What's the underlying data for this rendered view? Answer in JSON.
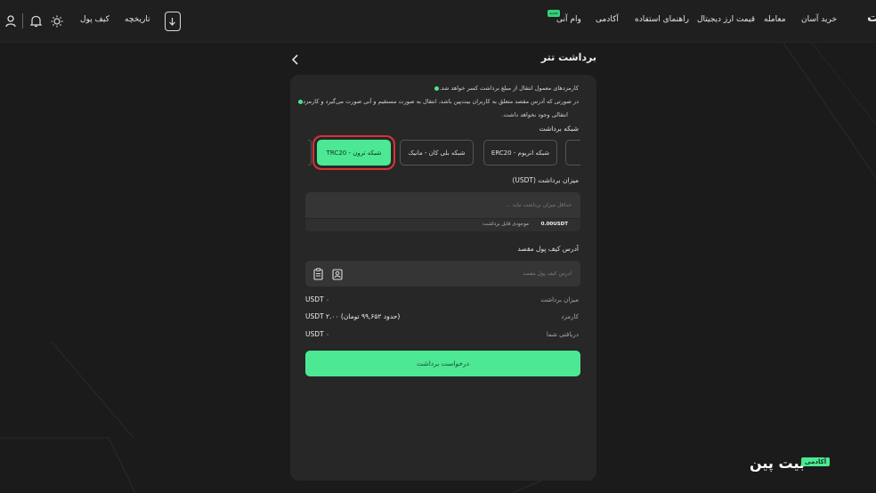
{
  "nav": {
    "items": [
      {
        "label": "خرید آسان"
      },
      {
        "label": "معامله"
      },
      {
        "label": "قیمت ارز دیجیتال"
      },
      {
        "label": "راهنمای استفاده"
      },
      {
        "label": "آکادمی"
      },
      {
        "label": "وام آنی"
      }
    ],
    "new_badge": "جدید",
    "history": "تاریخچه",
    "wallet": "کیف پول",
    "logo_char": "ت"
  },
  "page": {
    "title": "برداشت تتر"
  },
  "notes": [
    "کارمزدهای معمول انتقال از مبلغ برداشت کسر خواهد شد.",
    "در صورتی که آدرس مقصد متعلق به کاربران بیت‌پین باشد، انتقال به صورت مستقیم و آنی صورت می‌گیرد و کارمزد",
    "انتقالی وجود نخواهد داشت."
  ],
  "network": {
    "label": "شبکه برداشت",
    "options": [
      "شبکه ترون - TRC20",
      "شبکه بلی کان - مانیک",
      "شبکه اتریوم - ERC20"
    ],
    "selected": "شبکه ترون - TRC20"
  },
  "amount": {
    "label": "میزان برداشت (USDT)",
    "placeholder": "حداقل میزان برداشت نباید ...",
    "value": "",
    "balance_label": "موجودی قابل برداشت:",
    "balance_value": "0.00USDT"
  },
  "address": {
    "label": "آدرس کیف پول مقصد",
    "placeholder": "آدرس کیف پول مقصد",
    "value": ""
  },
  "summary": [
    {
      "label": "میزان برداشت",
      "value": "USDT ۰"
    },
    {
      "label": "کارمزد",
      "value": "(حدود ۹۹,۶۵۲ تومان) USDT ۲.۰۰"
    },
    {
      "label": "دریافتی شما",
      "value": "USDT ۰"
    }
  ],
  "submit_label": "درخواست برداشت",
  "brand": {
    "name": "بیت پین",
    "tag": "آکادمی"
  },
  "colors": {
    "accent": "#4ce893",
    "highlight": "#d93333",
    "background": "#1b1b1b",
    "card": "#272727"
  }
}
